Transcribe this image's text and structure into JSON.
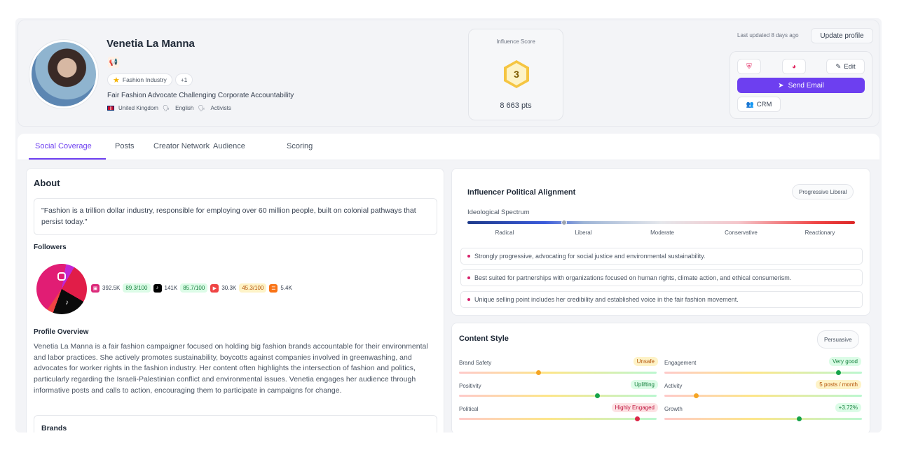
{
  "profile": {
    "name": "Venetia La Manna",
    "tags": [
      "Fashion Industry",
      "+1"
    ],
    "tagline": "Fair Fashion Advocate Challenging Corporate Accountability",
    "country": "United Kingdom",
    "language": "English",
    "audience": "Activists"
  },
  "score": {
    "label": "Influence Score",
    "rank": "3",
    "points": "8 663 pts"
  },
  "header_actions": {
    "last_updated": "Last updated 8 days ago",
    "update_label": "Update profile",
    "edit_label": "Edit",
    "send_email_label": "Send Email",
    "crm_label": "CRM"
  },
  "tabs": [
    {
      "label": "Social Coverage"
    },
    {
      "label": "Posts"
    },
    {
      "label": "Creator Network"
    },
    {
      "label": "Audience"
    },
    {
      "label": "Scoring"
    }
  ],
  "about": {
    "title": "About",
    "quote": "\"Fashion is a trillion dollar industry, responsible for employing over 60 million people, built on colonial pathways that persist today.\"",
    "followers_title": "Followers",
    "platforms": [
      {
        "name": "instagram",
        "followers": "392.5K",
        "score": "89.3/100",
        "color": "#dc2a7a",
        "level": "green"
      },
      {
        "name": "tiktok",
        "followers": "141K",
        "score": "85.7/100",
        "color": "#000000",
        "level": "green"
      },
      {
        "name": "youtube",
        "followers": "30.3K",
        "score": "45.3/100",
        "color": "#ef4444",
        "level": "amber"
      },
      {
        "name": "substack",
        "followers": "5.4K",
        "color": "#f97316"
      }
    ],
    "overview_title": "Profile Overview",
    "overview": "Venetia La Manna is a fair fashion campaigner focused on holding big fashion brands accountable for their environmental and labor practices. She actively promotes sustainability, boycotts against companies involved in greenwashing, and advocates for worker rights in the fashion industry. Her content often highlights the intersection of fashion and politics, particularly regarding the Israeli-Palestinian conflict and environmental issues. Venetia engages her audience through informative posts and calls to action, encouraging them to participate in campaigns for change.",
    "brands_title": "Brands"
  },
  "political": {
    "title": "Influencer Political Alignment",
    "badge": "Progressive Liberal",
    "spectrum_label": "Ideological Spectrum",
    "ticks": [
      "Radical",
      "Liberal",
      "Moderate",
      "Conservative",
      "Reactionary"
    ],
    "position": 0.25,
    "bullets": [
      "Strongly progressive, advocating for social justice and environmental sustainability.",
      "Best suited for partnerships with organizations focused on human rights, climate action, and ethical consumerism.",
      "Unique selling point includes her credibility and established voice in the fair fashion movement."
    ]
  },
  "content_style": {
    "title": "Content Style",
    "badge": "Persuasive",
    "metrics": [
      {
        "label": "Brand Safety",
        "value": "Unsafe",
        "level": 0.4,
        "tone": "amber",
        "knob": "#f5a524"
      },
      {
        "label": "Engagement",
        "value": "Very good",
        "level": 0.88,
        "tone": "green",
        "knob": "#16a34a"
      },
      {
        "label": "Positivity",
        "value": "Uplifting",
        "level": 0.7,
        "tone": "green",
        "knob": "#16a34a"
      },
      {
        "label": "Activity",
        "value": "5 posts / month",
        "level": 0.16,
        "tone": "amber",
        "knob": "#f5a524"
      },
      {
        "label": "Political",
        "value": "Highly Engaged",
        "level": 0.9,
        "tone": "red",
        "knob": "#dc2647"
      },
      {
        "label": "Growth",
        "value": "+3.72%",
        "level": 0.68,
        "tone": "green",
        "knob": "#16a34a"
      }
    ]
  }
}
